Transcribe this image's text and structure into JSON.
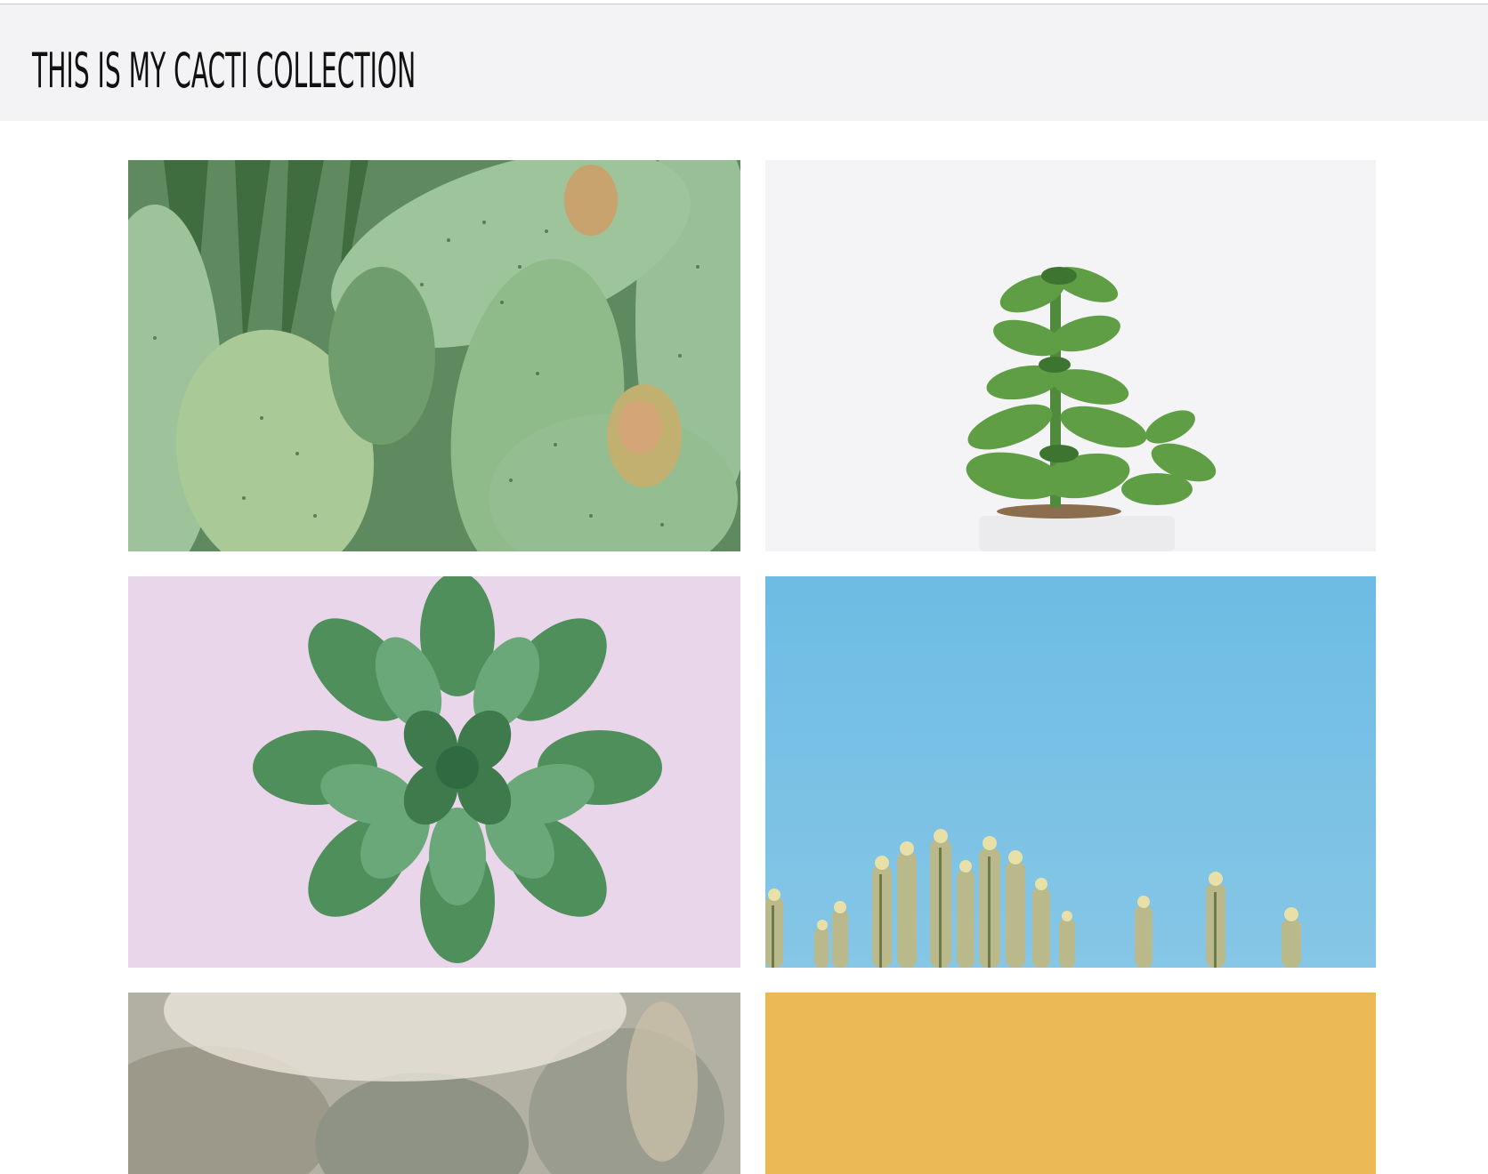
{
  "header": {
    "title": "THIS IS MY CACTI COLLECTION"
  },
  "colors": {
    "header_bg": "#f3f3f5",
    "page_bg": "#ffffff",
    "title_color": "#111111"
  },
  "gallery": {
    "photos": [
      {
        "subject": "prickly pear cactus pads with fruit",
        "dominant_color": "#8fb48e"
      },
      {
        "subject": "succulent in white pot on white background",
        "dominant_color": "#f4f4f6"
      },
      {
        "subject": "echeveria rosette on pink background",
        "dominant_color": "#e8d4e8"
      },
      {
        "subject": "cactus tops against blue sky",
        "dominant_color": "#7bbfe3"
      },
      {
        "subject": "hazy cactus garden",
        "dominant_color": "#a9a89a"
      },
      {
        "subject": "yellow backdrop",
        "dominant_color": "#ebb955"
      }
    ]
  }
}
